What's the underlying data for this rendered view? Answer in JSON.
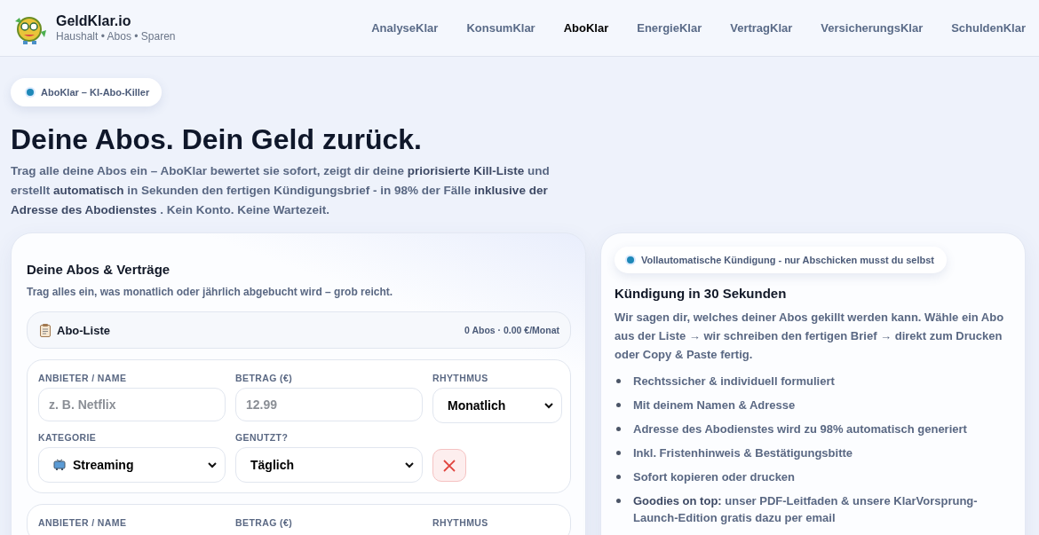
{
  "header": {
    "brand": "GeldKlar.io",
    "tagline": "Haushalt • Abos • Sparen",
    "nav": [
      {
        "label": "AnalyseKlar",
        "selected": false
      },
      {
        "label": "KonsumKlar",
        "selected": false
      },
      {
        "label": "AboKlar",
        "selected": true
      },
      {
        "label": "EnergieKlar",
        "selected": false
      },
      {
        "label": "VertragKlar",
        "selected": false
      },
      {
        "label": "VersicherungsKlar",
        "selected": false
      },
      {
        "label": "SchuldenKlar",
        "selected": false
      }
    ]
  },
  "hero": {
    "badge": "AboKlar – KI-Abo-Killer",
    "title": "Deine Abos. Dein Geld zurück.",
    "intro": "Trag alle deine Abos ein – AboKlar bewertet sie sofort, zeigt dir deine **priorisierte Kill-Liste** und erstellt **automatisch** in Sekunden den fertigen Kündigungsbrief - in 98% der Fälle **inklusive der Adresse des Abodienstes** . Kein Konto. Keine Wartezeit."
  },
  "form_card": {
    "title": "Deine Abos & Verträge",
    "subtitle": "Trag alles ein, was monatlich oder jährlich abgebucht wird – grob reicht.",
    "list_header": {
      "title": "Abo-Liste",
      "summary": "0 Abos · 0.00 €/Monat"
    },
    "entries": [
      {
        "fields": [
          {
            "kind": "text",
            "label": "ANBIETER / NAME",
            "placeholder": "z. B. Netflix"
          },
          {
            "kind": "text",
            "label": "BETRAG (€)",
            "placeholder": "12.99"
          },
          {
            "kind": "select",
            "label": "RHYTHMUS",
            "value": "Monatlich"
          },
          {
            "kind": "category",
            "label": "KATEGORIE",
            "value": "Streaming"
          },
          {
            "kind": "select",
            "label": "GENUTZT?",
            "value": "Täglich"
          },
          {
            "kind": "delete"
          }
        ]
      },
      {
        "fields": [
          {
            "kind": "label",
            "label": "ANBIETER / NAME"
          },
          {
            "kind": "label",
            "label": "BETRAG (€)"
          },
          {
            "kind": "label",
            "label": "RHYTHMUS"
          }
        ]
      }
    ]
  },
  "info_card": {
    "badge": "Vollautomatische Kündigung - nur Abschicken musst du selbst",
    "title": "Kündigung in 30 Sekunden",
    "text": "Wir sagen dir, welches deiner Abos gekillt werden kann. Wähle ein Abo aus der Liste → wir schreiben den fertigen Brief → direkt zum Drucken oder Copy & Paste fertig.",
    "bullets": [
      "Rechtssicher & individuell formuliert",
      "Mit deinem Namen & Adresse",
      "Adresse des Abodienstes wird zu 98% automatisch generiert",
      "Inkl. Fristenhinweis & Bestätigungsbitte",
      "Sofort kopieren oder drucken",
      "**Goodies on top:** unser PDF-Leitfaden & unsere KlarVorsprung-Launch-Edition gratis dazu per email"
    ]
  }
}
